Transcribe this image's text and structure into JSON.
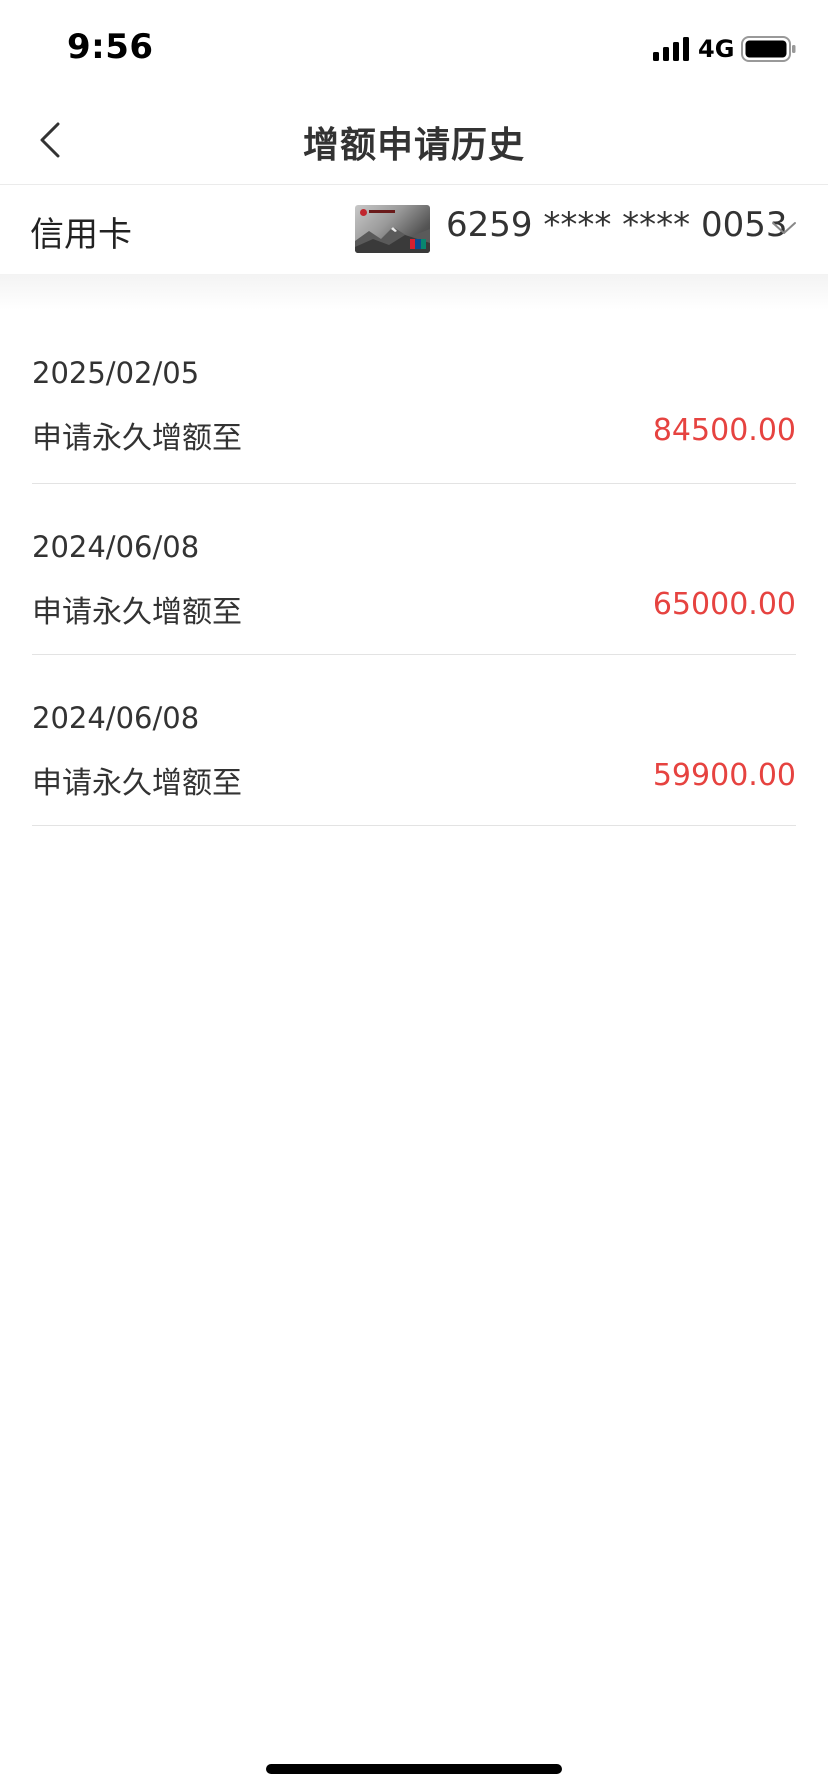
{
  "status_bar": {
    "time": "9:56",
    "network": "4G",
    "signal_icon": "cellular-signal-icon",
    "battery_icon": "battery-icon"
  },
  "header": {
    "title": "增额申请历史",
    "back_icon": "chevron-left-icon"
  },
  "card_selector": {
    "label": "信用卡",
    "card_number": "6259 **** **** 0053",
    "dropdown_icon": "chevron-down-icon"
  },
  "history": {
    "items": [
      {
        "date": "2025/02/05",
        "description": "申请永久增额至",
        "amount": "84500.00"
      },
      {
        "date": "2024/06/08",
        "description": "申请永久增额至",
        "amount": "65000.00"
      },
      {
        "date": "2024/06/08",
        "description": "申请永久增额至",
        "amount": "59900.00"
      }
    ]
  },
  "colors": {
    "amount": "#e64340",
    "text": "#333333",
    "divider": "#e3e3e3"
  }
}
